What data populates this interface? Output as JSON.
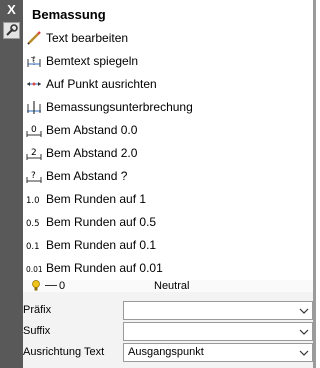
{
  "sidebar": {
    "close_label": "X",
    "pin_icon": "wrench-icon"
  },
  "header": {
    "title": "Bemassung"
  },
  "commands": [
    {
      "label": "Text bearbeiten",
      "icon": "pencil-text-icon"
    },
    {
      "label": "Bemtext spiegeln",
      "icon": "mirror-dimtext-icon"
    },
    {
      "label": "Auf Punkt ausrichten",
      "icon": "align-point-icon"
    },
    {
      "label": "Bemassungsunterbrechung",
      "icon": "dim-break-icon"
    },
    {
      "label": "Bem Abstand 0.0",
      "icon": "spacing-icon",
      "glyph": "0"
    },
    {
      "label": "Bem Abstand 2.0",
      "icon": "spacing-icon",
      "glyph": "2"
    },
    {
      "label": "Bem Abstand ?",
      "icon": "spacing-icon",
      "glyph": "?"
    },
    {
      "label": "Bem Runden auf 1",
      "icon": "round-icon",
      "glyph": "1.0"
    },
    {
      "label": "Bem Runden auf 0.5",
      "icon": "round-icon",
      "glyph": "0.5"
    },
    {
      "label": "Bem Runden auf 0.1",
      "icon": "round-icon",
      "glyph": "0.1"
    },
    {
      "label": "Bem Runden auf 0.01",
      "icon": "round-icon",
      "glyph": "0.01"
    }
  ],
  "properties": {
    "layer_row": {
      "layer_name": "0",
      "value": "Neutral"
    },
    "rows": [
      {
        "label": "Präfix",
        "value": ""
      },
      {
        "label": "Suffix",
        "value": ""
      },
      {
        "label": "Ausrichtung Text",
        "value": "Ausgangspunkt"
      }
    ]
  },
  "colors": {
    "sidebar": "#595959",
    "accent_blue": "#2e6fc9",
    "bulb": "#f0c419"
  }
}
